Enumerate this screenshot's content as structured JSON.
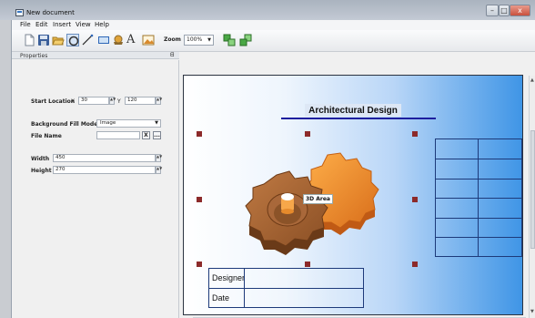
{
  "window": {
    "title": "New document",
    "min": "–",
    "max": "□",
    "close": "x"
  },
  "menu": [
    "File",
    "Edit",
    "Insert",
    "View",
    "Help"
  ],
  "toolbar": {
    "icons": [
      "new-icon",
      "save-icon",
      "open-icon",
      "select-tool-icon",
      "line-tool-icon",
      "rectangle-tool-icon",
      "gear-3d-icon",
      "text-tool-icon",
      "image-tool-icon",
      "bring-forward-icon",
      "send-backward-icon"
    ],
    "zoom_label": "Zoom",
    "zoom_value": "100%"
  },
  "properties": {
    "title": "Properties",
    "pin": "ᗺ",
    "start_location_label": "Start Location",
    "x_label": "X",
    "x_value": "30",
    "y_label": "Y",
    "y_value": "120",
    "fill_mode_label": "Background Fill Mode",
    "fill_mode_value": "Image",
    "file_name_label": "File Name",
    "file_name_value": "",
    "clear_btn": "X",
    "browse_btn": "...",
    "width_label": "Width",
    "width_value": "450",
    "height_label": "Height",
    "height_value": "270"
  },
  "document": {
    "title": "Architectural Design",
    "area_label": "3D Area",
    "title_block": [
      {
        "label": "Designer",
        "value": ""
      },
      {
        "label": "Date",
        "value": ""
      }
    ]
  },
  "colors": {
    "accent_blue": "#3f95e6",
    "handle": "#8c2a2a",
    "line": "#1d1e9e"
  }
}
